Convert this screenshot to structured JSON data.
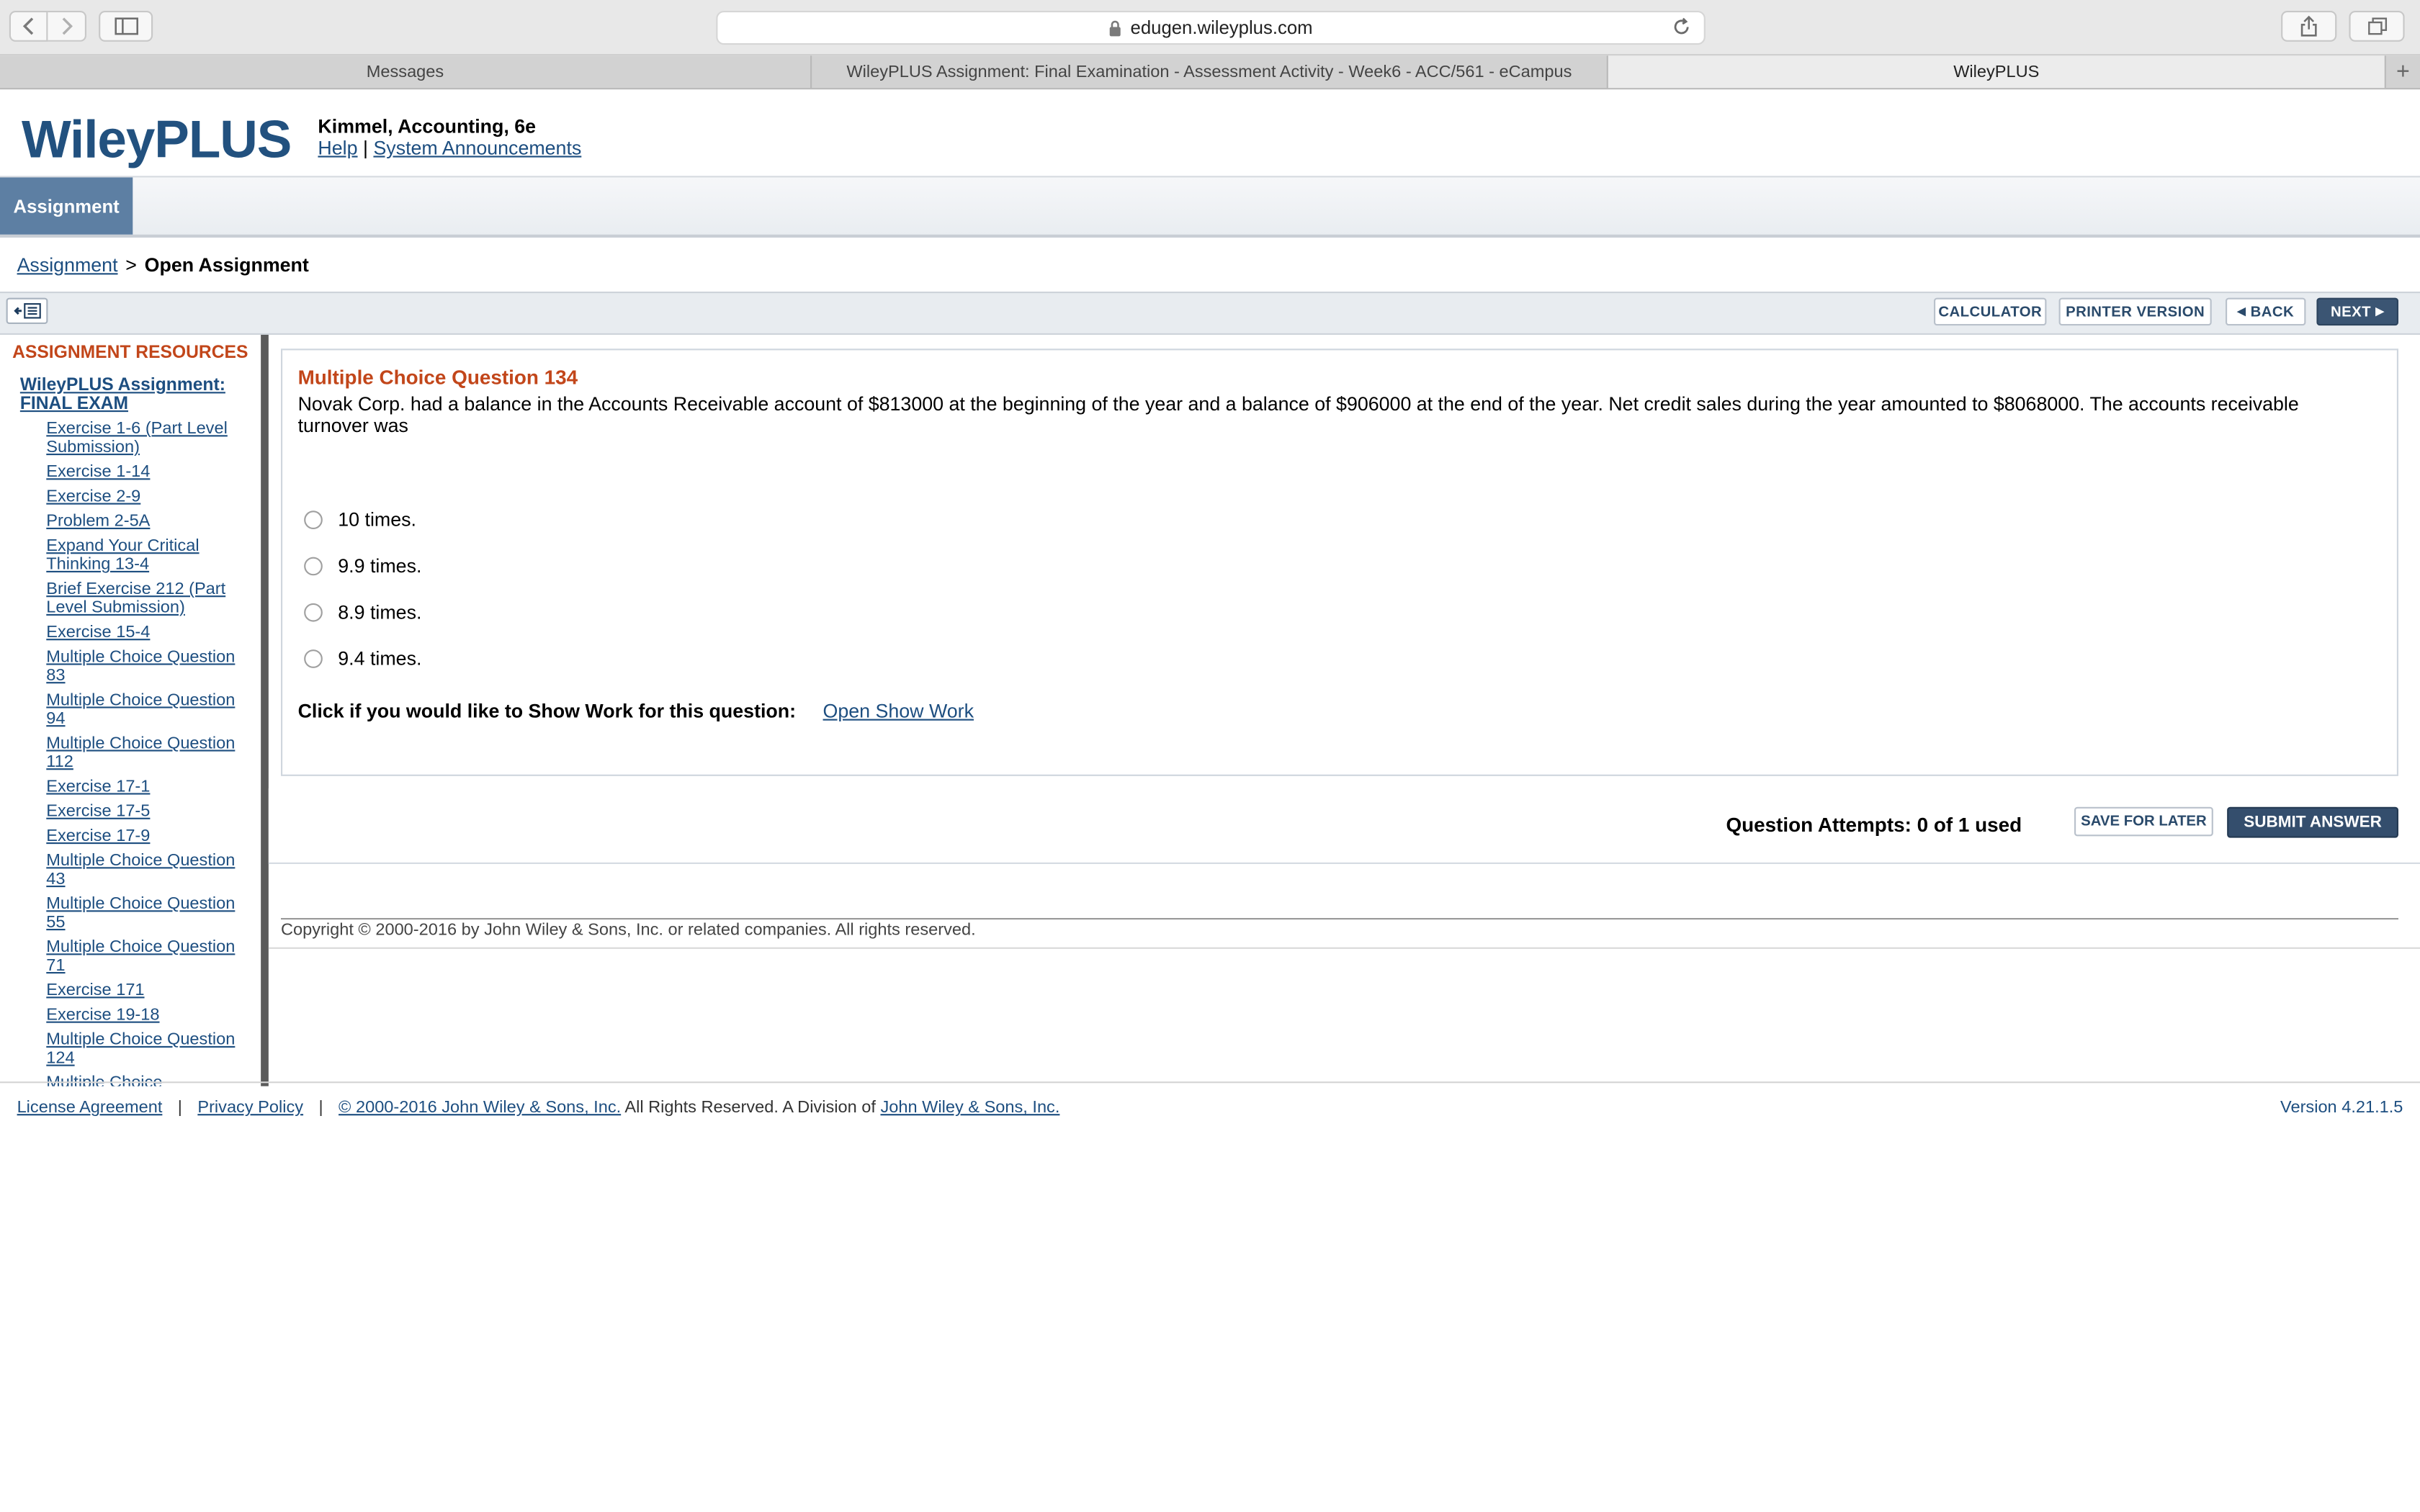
{
  "browser": {
    "url": "edugen.wileyplus.com",
    "tabs": [
      {
        "label": "Messages"
      },
      {
        "label": "WileyPLUS Assignment: Final Examination - Assessment Activity - Week6 - ACC/561 - eCampus"
      },
      {
        "label": "WileyPLUS"
      }
    ]
  },
  "header": {
    "logo": "WileyPLUS",
    "course": "Kimmel, Accounting, 6e",
    "help": "Help",
    "sep": "|",
    "announcements": "System Announcements"
  },
  "nav": {
    "active_tab": "Assignment"
  },
  "breadcrumb": {
    "link": "Assignment",
    "sep": ">",
    "current": "Open Assignment"
  },
  "actions": {
    "calculator": "CALCULATOR",
    "printer": "PRINTER VERSION",
    "back": "BACK",
    "next": "NEXT"
  },
  "resources": {
    "title": "ASSIGNMENT RESOURCES",
    "assignment": "WileyPLUS Assignment: FINAL EXAM",
    "items": [
      "Exercise 1-6 (Part Level Submission)",
      "Exercise 1-14",
      "Exercise 2-9",
      "Problem 2-5A",
      "Expand Your Critical Thinking 13-4",
      "Brief Exercise 212 (Part Level Submission)",
      "Exercise 15-4",
      "Multiple Choice Question 83",
      "Multiple Choice Question 94",
      "Multiple Choice Question 112",
      "Exercise 17-1",
      "Exercise 17-5",
      "Exercise 17-9",
      "Multiple Choice Question 43",
      "Multiple Choice Question 55",
      "Multiple Choice Question 71",
      "Exercise 171",
      "Exercise 19-18",
      "Multiple Choice Question 124",
      "Multiple Choice"
    ]
  },
  "question": {
    "title": "Multiple Choice Question 134",
    "text": "Novak Corp. had a balance in the Accounts Receivable account of $813000 at the beginning of the year and a balance of $906000 at the end of the year. Net credit sales during the year amounted to $8068000. The accounts receivable turnover was",
    "options": [
      "10 times.",
      "9.9 times.",
      "8.9 times.",
      "9.4 times."
    ],
    "show_work_prompt": "Click if you would like to Show Work for this question:",
    "show_work_link": "Open Show Work"
  },
  "submit": {
    "attempts": "Question Attempts: 0 of 1 used",
    "save_later": "SAVE FOR LATER",
    "submit_answer": "SUBMIT ANSWER"
  },
  "copyright": "Copyright © 2000-2016 by John Wiley & Sons, Inc. or related companies. All rights reserved.",
  "footer": {
    "license": "License Agreement",
    "privacy": "Privacy Policy",
    "sep": "|",
    "copy_link": "© 2000-2016 John Wiley & Sons, Inc.",
    "copy_text": " All Rights Reserved. A Division of ",
    "division_link": "John Wiley & Sons, Inc.",
    "version": "Version 4.21.1.5"
  }
}
